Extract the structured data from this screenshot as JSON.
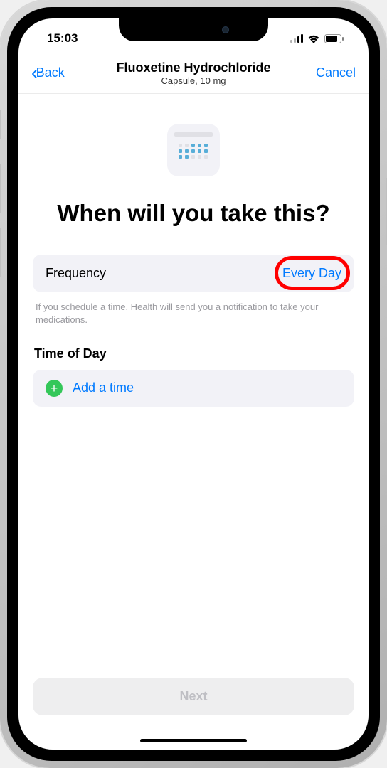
{
  "status": {
    "time": "15:03"
  },
  "nav": {
    "back_label": "Back",
    "title": "Fluoxetine Hydrochloride",
    "subtitle": "Capsule, 10 mg",
    "cancel_label": "Cancel"
  },
  "heading": "When will you take this?",
  "frequency": {
    "label": "Frequency",
    "value": "Every Day"
  },
  "info_text": "If you schedule a time, Health will send you a notification to take your medications.",
  "time_section": {
    "heading": "Time of Day",
    "add_label": "Add a time"
  },
  "next_label": "Next",
  "annotation": {
    "highlight_target": "frequency-value"
  }
}
